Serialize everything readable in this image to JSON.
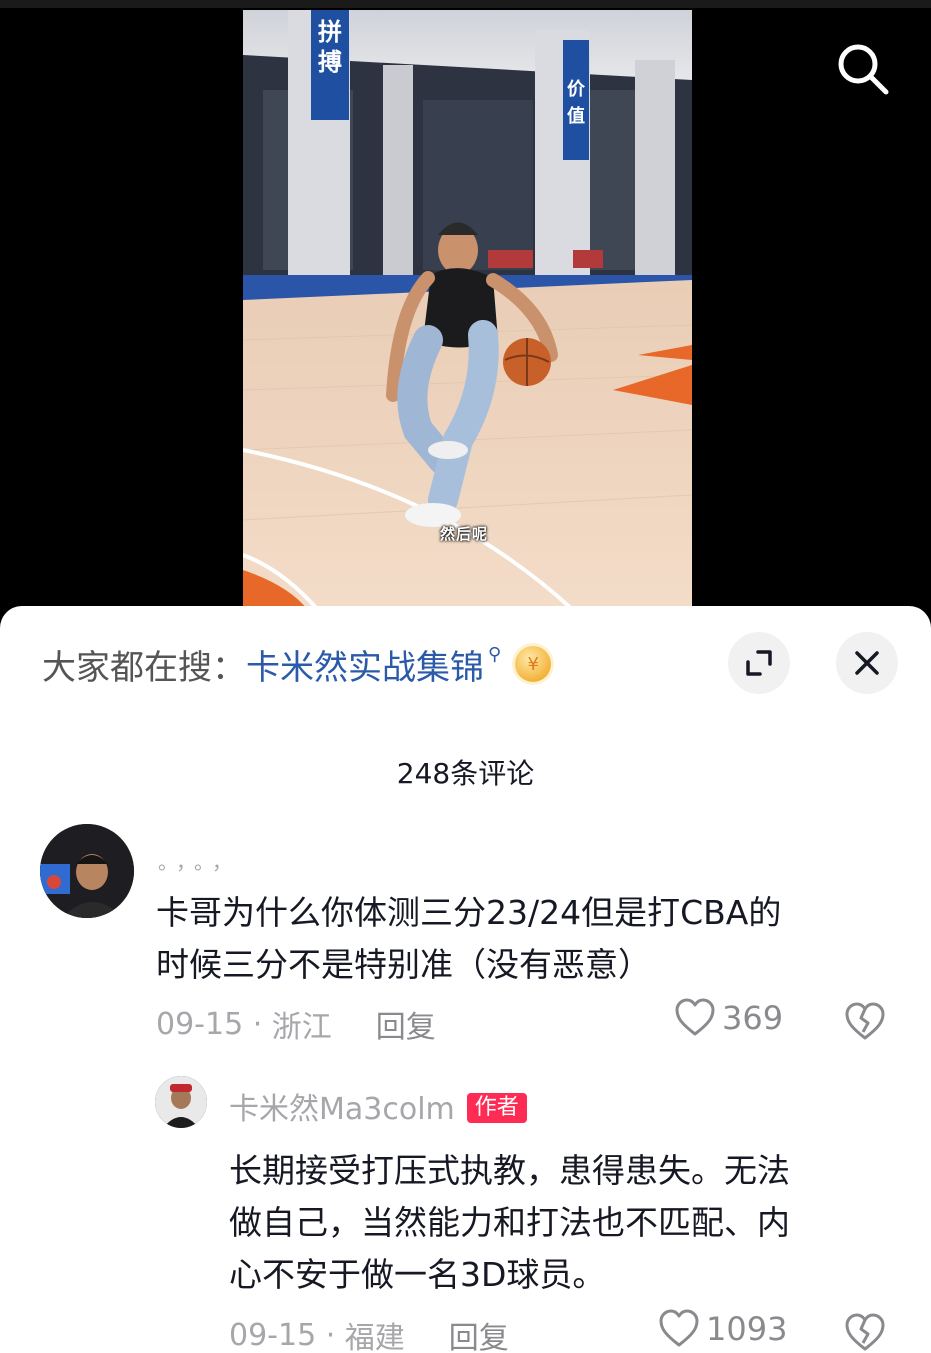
{
  "video": {
    "banner_left": "拼搏",
    "banner_right": "价值",
    "caption": "然后呢"
  },
  "search_hint": {
    "prefix": "大家都在搜：",
    "keyword": "卡米然实战集锦",
    "coin_symbol": "¥"
  },
  "comment_count": "248条评论",
  "comments": [
    {
      "username": "。，。，",
      "text_line1": "卡哥为什么你体测三分23/24但是打CBA的",
      "text_line2": "时候三分不是特别准（没有恶意）",
      "date": "09-15",
      "location": "浙江",
      "reply_label": "回复",
      "likes": "369"
    }
  ],
  "reply": {
    "username": "卡米然Ma3colm",
    "badge": "作者",
    "text_line1": "长期接受打压式执教，患得患失。无法",
    "text_line2": "做自己，当然能力和打法也不匹配、内",
    "text_line3": "心不安于做一名3D球员。",
    "date": "09-15",
    "location": "福建",
    "reply_label": "回复",
    "likes": "1093"
  },
  "colors": {
    "accent_blue": "#2b5ba8",
    "author_badge": "#fe2c55",
    "muted_text": "#a7a7ab"
  },
  "icons": [
    "search-icon",
    "expand-icon",
    "close-icon",
    "heart-icon",
    "broken-heart-icon",
    "coin-icon",
    "search-small-icon"
  ]
}
